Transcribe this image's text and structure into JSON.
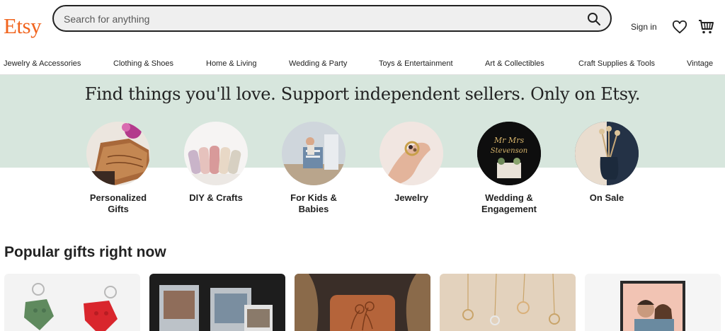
{
  "header": {
    "logo": "Etsy",
    "search_placeholder": "Search for anything",
    "sign_in": "Sign in"
  },
  "categories": [
    "Jewelry & Accessories",
    "Clothing & Shoes",
    "Home & Living",
    "Wedding & Party",
    "Toys & Entertainment",
    "Art & Collectibles",
    "Craft Supplies & Tools",
    "Vintage"
  ],
  "hero": {
    "title": "Find things you'll love. Support independent sellers. Only on Etsy.",
    "items": [
      {
        "label": "Personalized\nGifts"
      },
      {
        "label": "DIY & Crafts"
      },
      {
        "label": "For Kids &\nBabies"
      },
      {
        "label": "Jewelry"
      },
      {
        "label": "Wedding &\nEngagement"
      },
      {
        "label": "On Sale"
      }
    ]
  },
  "popular": {
    "title": "Popular gifts right now"
  },
  "colors": {
    "brand": "#f1641e",
    "hero_bg": "#d7e6dd"
  }
}
